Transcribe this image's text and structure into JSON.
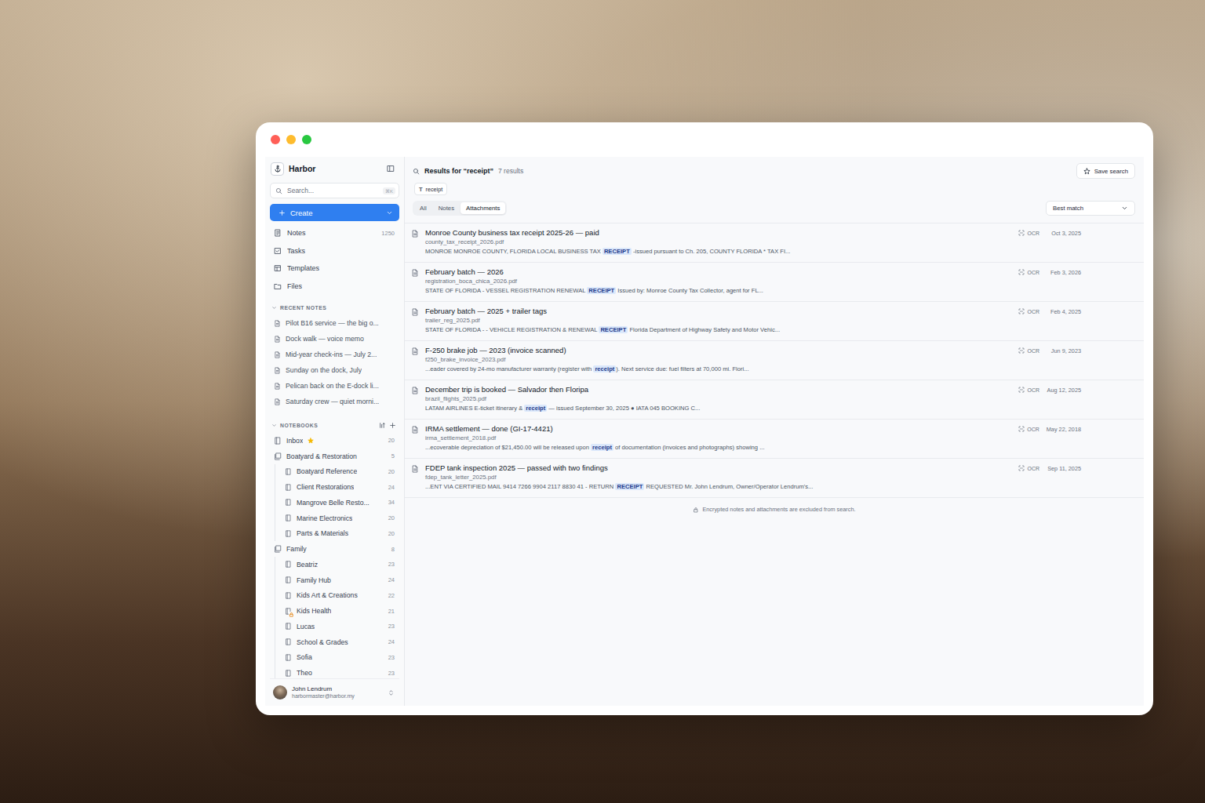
{
  "app": {
    "name": "Harbor"
  },
  "sidebar": {
    "search": {
      "placeholder": "Search...",
      "shortcut": "⌘K"
    },
    "create": {
      "label": "Create"
    },
    "nav": [
      {
        "label": "Notes",
        "count": "1250"
      },
      {
        "label": "Tasks",
        "count": null
      },
      {
        "label": "Templates",
        "count": null
      },
      {
        "label": "Files",
        "count": null
      }
    ],
    "recent": {
      "header": "RECENT NOTES",
      "expanded": true,
      "items": [
        "Pilot B16 service — the big o...",
        "Dock walk — voice memo",
        "Mid-year check-ins — July 2...",
        "Sunday on the dock, July",
        "Pelican back on the E-dock li...",
        "Saturday crew — quiet morni..."
      ]
    },
    "notebooks": {
      "header": "NOTEBOOKS",
      "expanded": true,
      "items": [
        {
          "name": "Inbox",
          "count": "20",
          "kind": "notebook",
          "starred": true,
          "locked": false,
          "expanded": false,
          "children": []
        },
        {
          "name": "Boatyard & Restoration",
          "count": "5",
          "kind": "stack",
          "starred": false,
          "locked": false,
          "expanded": true,
          "children": [
            {
              "name": "Boatyard Reference",
              "count": "20",
              "starred": false,
              "locked": false
            },
            {
              "name": "Client Restorations",
              "count": "24",
              "starred": false,
              "locked": false
            },
            {
              "name": "Mangrove Belle Resto...",
              "count": "34",
              "starred": false,
              "locked": false
            },
            {
              "name": "Marine Electronics",
              "count": "20",
              "starred": false,
              "locked": false
            },
            {
              "name": "Parts & Materials",
              "count": "20",
              "starred": false,
              "locked": false
            }
          ]
        },
        {
          "name": "Family",
          "count": "8",
          "kind": "stack",
          "starred": false,
          "locked": false,
          "expanded": true,
          "children": [
            {
              "name": "Beatriz",
              "count": "23",
              "starred": false,
              "locked": false
            },
            {
              "name": "Family Hub",
              "count": "24",
              "starred": false,
              "locked": false
            },
            {
              "name": "Kids Art & Creations",
              "count": "22",
              "starred": false,
              "locked": false
            },
            {
              "name": "Kids Health",
              "count": "21",
              "starred": false,
              "locked": true
            },
            {
              "name": "Lucas",
              "count": "23",
              "starred": false,
              "locked": false
            },
            {
              "name": "School & Grades",
              "count": "24",
              "starred": false,
              "locked": false
            },
            {
              "name": "Sofia",
              "count": "23",
              "starred": false,
              "locked": false
            },
            {
              "name": "Theo",
              "count": "23",
              "starred": false,
              "locked": false
            }
          ]
        }
      ]
    },
    "user": {
      "name": "John Lendrum",
      "email": "harbormaster@harbor.my"
    }
  },
  "search": {
    "title": "Results for “receipt”",
    "count": "7 results",
    "save": "Save search",
    "chip": {
      "icon": "T",
      "label": "receipt"
    },
    "tabs": [
      {
        "label": "All",
        "selected": false
      },
      {
        "label": "Notes",
        "selected": false
      },
      {
        "label": "Attachments",
        "selected": true
      }
    ],
    "sort": "Best match",
    "footer": "Encrypted notes and attachments are excluded from search."
  },
  "results": [
    {
      "title": "Monroe County business tax receipt 2025-26 — paid",
      "file": "county_tax_receipt_2026.pdf",
      "snippet": {
        "before": "MONROE MONROE COUNTY, FLORIDA LOCAL BUSINESS TAX ",
        "match": "RECEIPT",
        "after": " -issued pursuant to Ch. 205, COUNTY FLORIDA * TAX FI..."
      },
      "badge": "OCR",
      "date": "Oct 3, 2025"
    },
    {
      "title": "February batch — 2026",
      "file": "registration_boca_chica_2026.pdf",
      "snippet": {
        "before": "STATE OF FLORIDA - VESSEL REGISTRATION RENEWAL ",
        "match": "RECEIPT",
        "after": " Issued by: Monroe County Tax Collector, agent for FL..."
      },
      "badge": "OCR",
      "date": "Feb 3, 2026"
    },
    {
      "title": "February batch — 2025 + trailer tags",
      "file": "trailer_reg_2025.pdf",
      "snippet": {
        "before": "STATE OF FLORIDA - - VEHICLE REGISTRATION & RENEWAL ",
        "match": "RECEIPT",
        "after": " Florida Department of Highway Safety and Motor Vehic..."
      },
      "badge": "OCR",
      "date": "Feb 4, 2025"
    },
    {
      "title": "F-250 brake job — 2023 (invoice scanned)",
      "file": "f250_brake_invoice_2023.pdf",
      "snippet": {
        "before": "...eader covered by 24-mo manufacturer warranty (register with ",
        "match": "receipt",
        "after": "). Next service due: fuel filters at 70,000 mi. Flori..."
      },
      "badge": "OCR",
      "date": "Jun 9, 2023"
    },
    {
      "title": "December trip is booked — Salvador then Floripa",
      "file": "brazil_flights_2025.pdf",
      "snippet": {
        "before": "LATAM AIRLINES E-ticket itinerary & ",
        "match": "receipt",
        "after": " — issued September 30, 2025 ● IATA 045 BOOKING C..."
      },
      "badge": "OCR",
      "date": "Aug 12, 2025"
    },
    {
      "title": "IRMA settlement — done (GI-17-4421)",
      "file": "irma_settlement_2018.pdf",
      "snippet": {
        "before": "...ecoverable depreciation of $21,450.00 will be released upon ",
        "match": "receipt",
        "after": " of documentation (invoices and photographs) showing ..."
      },
      "badge": "OCR",
      "date": "May 22, 2018"
    },
    {
      "title": "FDEP tank inspection 2025 — passed with two findings",
      "file": "fdep_tank_letter_2025.pdf",
      "snippet": {
        "before": "...ENT VIA CERTIFIED MAIL 9414 7266 9904 2117 8830 41 - RETURN ",
        "match": "RECEIPT",
        "after": " REQUESTED Mr. John Lendrum, Owner/Operator Lendrum's..."
      },
      "badge": "OCR",
      "date": "Sep 11, 2025"
    }
  ]
}
